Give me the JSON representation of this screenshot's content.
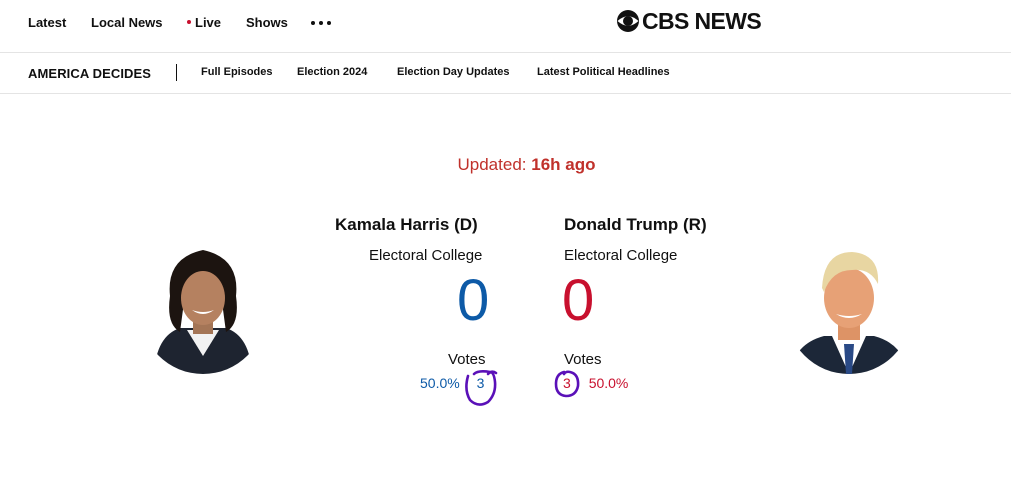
{
  "nav": {
    "items": [
      "Latest",
      "Local News",
      "Live",
      "Shows"
    ],
    "logo_text": "CBS NEWS"
  },
  "subnav": {
    "brand": "AMERICA DECIDES",
    "links": [
      "Full Episodes",
      "Election 2024",
      "Election Day Updates",
      "Latest Political Headlines"
    ]
  },
  "updated": {
    "label": "Updated:",
    "value": "16h ago"
  },
  "candidates": [
    {
      "name": "Kamala Harris (D)",
      "ec_label": "Electoral College",
      "ec_value": "0",
      "votes_label": "Votes",
      "vote_pct": "50.0%",
      "vote_count": "3",
      "color": "#0d5aa7"
    },
    {
      "name": "Donald Trump (R)",
      "ec_label": "Electoral College",
      "ec_value": "0",
      "votes_label": "Votes",
      "vote_pct": "50.0%",
      "vote_count": "3",
      "color": "#c8102e"
    }
  ],
  "colors": {
    "dem": "#0d5aa7",
    "rep": "#c8102e",
    "annotation": "#5a10b8"
  },
  "icons": [
    "more-icon",
    "cbs-eye-icon"
  ]
}
